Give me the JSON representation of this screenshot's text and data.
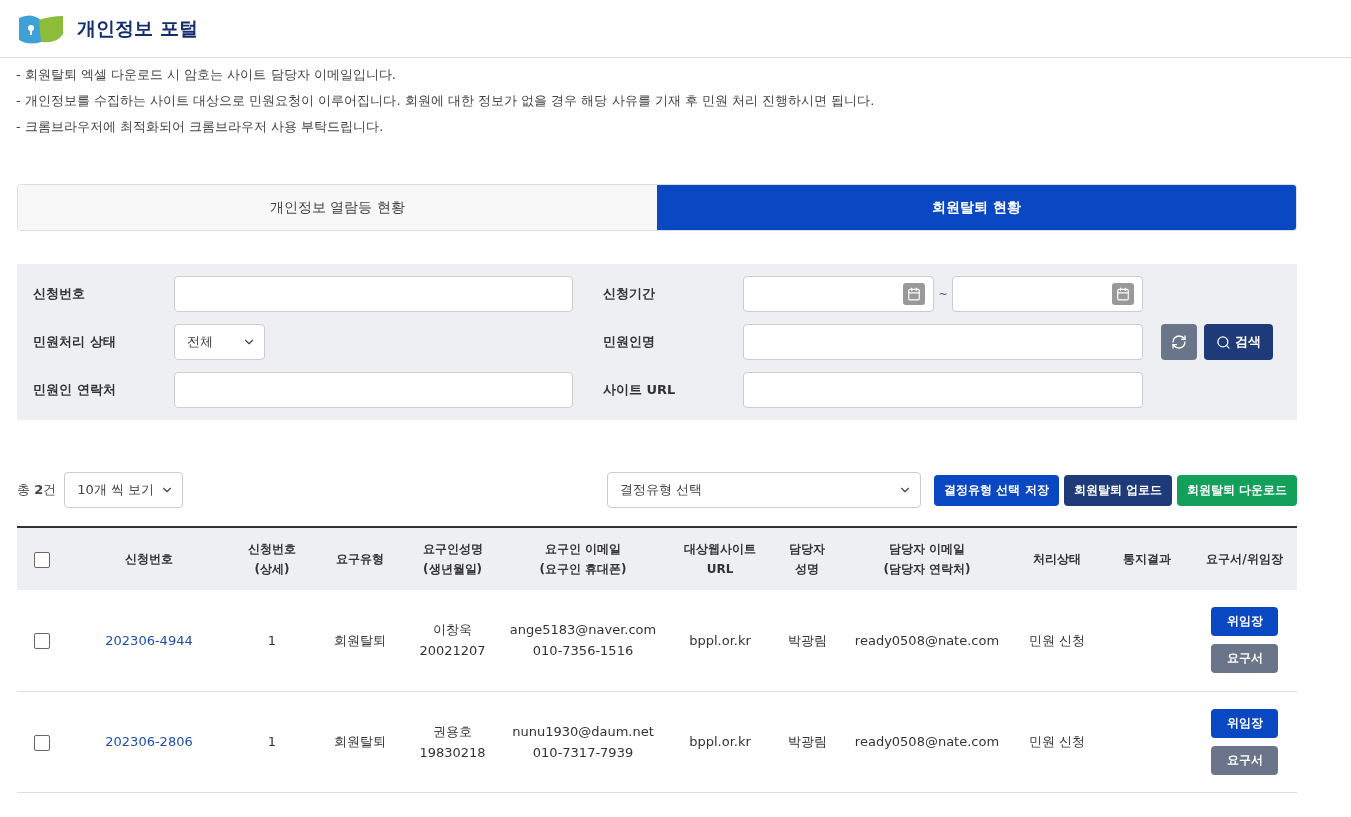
{
  "header": {
    "title": "개인정보 포털"
  },
  "notices": [
    "- 회원탈퇴 엑셀 다운로드 시 암호는 사이트 담당자 이메일입니다.",
    "- 개인정보를 수집하는 사이트 대상으로 민원요청이 이루어집니다. 회원에 대한 정보가 없을 경우 해당 사유를 기재 후 민원 처리 진행하시면 됩니다.",
    "- 크롬브라우저에 최적화되어 크롬브라우저 사용 부탁드립니다."
  ],
  "tabs": [
    {
      "label": "개인정보 열람등 현황",
      "selected": false
    },
    {
      "label": "회원탈퇴 현황",
      "selected": true
    }
  ],
  "filters": {
    "request_no": {
      "label": "신청번호"
    },
    "period": {
      "label": "신청기간",
      "separator": "~"
    },
    "status": {
      "label": "민원처리 상태",
      "value": "전체"
    },
    "applicant_name": {
      "label": "민원인명"
    },
    "applicant_contact": {
      "label": "민원인 연락처"
    },
    "site_url": {
      "label": "사이트 URL"
    },
    "search_button": "검색"
  },
  "toolbar": {
    "total_prefix": "총",
    "total_count": "2",
    "total_suffix": "건",
    "page_size": "10개 씩 보기",
    "decision_type": "결정유형 선택",
    "buttons": [
      {
        "label": "결정유형 선택 저장",
        "color": "#0a47c2"
      },
      {
        "label": "회원탈퇴 업로드",
        "color": "#1e3a78"
      },
      {
        "label": "회원탈퇴 다운로드",
        "color": "#13a05a"
      }
    ]
  },
  "table": {
    "columns": [
      {
        "lines": [
          "신청번호"
        ]
      },
      {
        "lines": [
          "신청번호",
          "(상세)"
        ]
      },
      {
        "lines": [
          "요구유형"
        ]
      },
      {
        "lines": [
          "요구인성명",
          "(생년월일)"
        ]
      },
      {
        "lines": [
          "요구인 이메일",
          "(요구인 휴대폰)"
        ]
      },
      {
        "lines": [
          "대상웹사이트",
          "URL"
        ]
      },
      {
        "lines": [
          "담당자",
          "성명"
        ]
      },
      {
        "lines": [
          "담당자 이메일",
          "(담당자 연락처)"
        ]
      },
      {
        "lines": [
          "처리상태"
        ]
      },
      {
        "lines": [
          "통지결과"
        ]
      },
      {
        "lines": [
          "요구서/위임장"
        ]
      }
    ],
    "header_checked": false,
    "rows": [
      {
        "checked": false,
        "request_no": "202306-4944",
        "detail": "1",
        "type": "회원탈퇴",
        "name": "이창욱",
        "birth": "20021207",
        "email": "ange5183@naver.com",
        "phone": "010-7356-1516",
        "site": "bppl.or.kr",
        "manager": "박광림",
        "manager_email": "ready0508@nate.com",
        "status": "민원 신청",
        "buttons": [
          "위임장",
          "요구서"
        ]
      },
      {
        "checked": false,
        "request_no": "202306-2806",
        "detail": "1",
        "type": "회원탈퇴",
        "name": "권용호",
        "birth": "19830218",
        "email": "nunu1930@daum.net",
        "phone": "010-7317-7939",
        "site": "bppl.or.kr",
        "manager": "박광림",
        "manager_email": "ready0508@nate.com",
        "status": "민원 신청",
        "buttons": [
          "위임장",
          "요구서"
        ]
      }
    ]
  }
}
